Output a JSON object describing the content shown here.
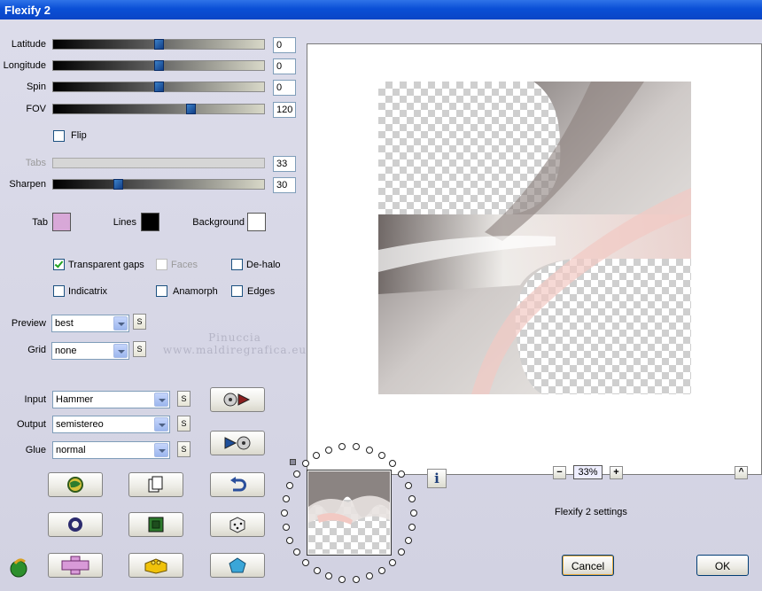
{
  "window": {
    "title": "Flexify 2"
  },
  "sliders": [
    {
      "label": "Latitude",
      "value": "0",
      "level": 0.5
    },
    {
      "label": "Longitude",
      "value": "0",
      "level": 0.5
    },
    {
      "label": "Spin",
      "value": "0",
      "level": 0.5
    },
    {
      "label": "FOV",
      "value": "120",
      "level": 0.66
    },
    {
      "label": "Tabs",
      "value": "33",
      "level": 0,
      "disabled": true
    },
    {
      "label": "Sharpen",
      "value": "30",
      "level": 0.3
    }
  ],
  "flip": {
    "label": "Flip",
    "checked": false
  },
  "colors": {
    "tab": {
      "label": "Tab",
      "color": "#d8a8d8"
    },
    "lines": {
      "label": "Lines",
      "color": "#000000"
    },
    "background": {
      "label": "Background",
      "color": "#ffffff"
    }
  },
  "options": {
    "transparent_gaps": {
      "label": "Transparent gaps",
      "checked": true
    },
    "faces": {
      "label": "Faces",
      "checked": false,
      "disabled": true
    },
    "de_halo": {
      "label": "De-halo",
      "checked": false
    },
    "indicatrix": {
      "label": "Indicatrix",
      "checked": false
    },
    "anamorph": {
      "label": "Anamorph",
      "checked": false
    },
    "edges": {
      "label": "Edges",
      "checked": false
    }
  },
  "dropdowns": {
    "preview": {
      "label": "Preview",
      "value": "best"
    },
    "grid": {
      "label": "Grid",
      "value": "none"
    },
    "input": {
      "label": "Input",
      "value": "Hammer"
    },
    "output": {
      "label": "Output",
      "value": "semistereo"
    },
    "glue": {
      "label": "Glue",
      "value": "normal"
    }
  },
  "s_button": "S",
  "watermark": {
    "line1": "Pinuccia",
    "line2": "www.maldiregrafica.eu"
  },
  "zoom": {
    "minus": "−",
    "value": "33%",
    "plus": "+"
  },
  "settings_text": "Flexify 2 settings",
  "info_button": "i",
  "up_button": "^",
  "buttons": {
    "cancel": "Cancel",
    "ok": "OK"
  }
}
